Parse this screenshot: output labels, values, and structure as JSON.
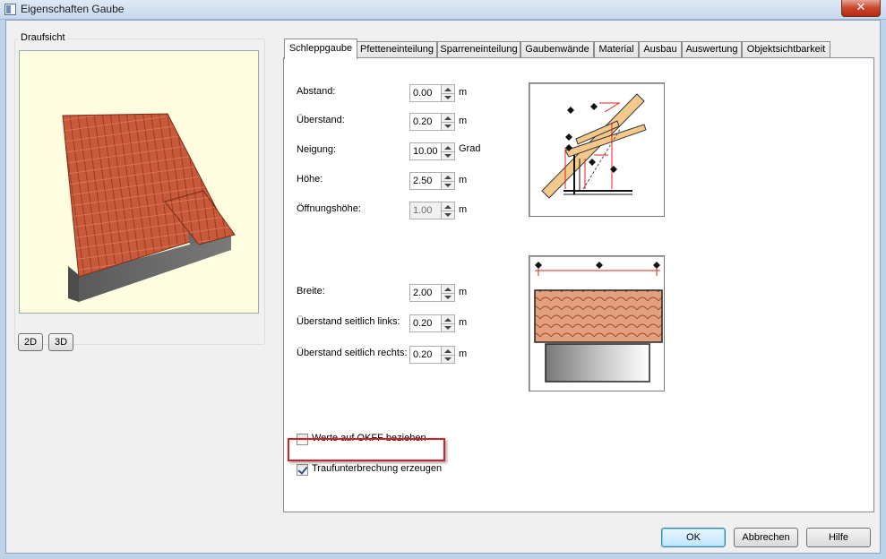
{
  "window": {
    "title": "Eigenschaften Gaube",
    "close_label": "✕"
  },
  "left_panel": {
    "group_label": "Draufsicht",
    "btn_2d": "2D",
    "btn_3d": "3D"
  },
  "tabs": [
    {
      "label": "Schleppgaube",
      "active": true
    },
    {
      "label": "Pfetteneinteilung",
      "active": false
    },
    {
      "label": "Sparreneinteilung",
      "active": false
    },
    {
      "label": "Gaubenwände",
      "active": false
    },
    {
      "label": "Material",
      "active": false
    },
    {
      "label": "Ausbau",
      "active": false
    },
    {
      "label": "Auswertung",
      "active": false
    },
    {
      "label": "Objektsichtbarkeit",
      "active": false
    }
  ],
  "fields_top": [
    {
      "label": "Abstand:",
      "value": "0.00",
      "unit": "m",
      "enabled": true
    },
    {
      "label": "Überstand:",
      "value": "0.20",
      "unit": "m",
      "enabled": true
    },
    {
      "label": "Neigung:",
      "value": "10.00",
      "unit": "Grad",
      "enabled": true
    },
    {
      "label": "Höhe:",
      "value": "2.50",
      "unit": "m",
      "enabled": true
    },
    {
      "label": "Öffnungshöhe:",
      "value": "1.00",
      "unit": "m",
      "enabled": false
    }
  ],
  "fields_bottom": [
    {
      "label": "Breite:",
      "value": "2.00",
      "unit": "m",
      "enabled": true
    },
    {
      "label": "Überstand seitlich links:",
      "value": "0.20",
      "unit": "m",
      "enabled": true
    },
    {
      "label": "Überstand seitlich rechts:",
      "value": "0.20",
      "unit": "m",
      "enabled": true
    }
  ],
  "checkboxes": [
    {
      "label": "Werte auf OKFF beziehen",
      "checked": false
    },
    {
      "label": "Traufunterbrechung erzeugen",
      "checked": true
    }
  ],
  "buttons": {
    "ok": "OK",
    "cancel": "Abbrechen",
    "help": "Hilfe"
  },
  "colors": {
    "roof_tile": "#c8593a",
    "roof_tile_dark": "#8a3520",
    "wall_gray": "#6b6b6b",
    "preview_bg": "#fffde0",
    "highlight": "#d41f26"
  }
}
